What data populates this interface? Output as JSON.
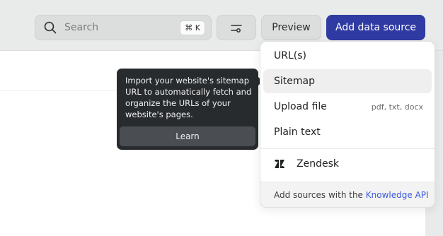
{
  "search": {
    "placeholder": "Search",
    "shortcut": "⌘ K",
    "icon": "search-icon"
  },
  "toolbar": {
    "filter_icon": "sliders-icon",
    "preview_label": "Preview",
    "add_label": "Add data source",
    "accent": "#2f3ba3"
  },
  "menu": {
    "items": [
      {
        "label": "URL(s)",
        "hint": ""
      },
      {
        "label": "Sitemap",
        "hint": ""
      },
      {
        "label": "Upload file",
        "hint": "pdf, txt, docx"
      },
      {
        "label": "Plain text",
        "hint": ""
      }
    ],
    "integration": {
      "label": "Zendesk",
      "icon": "zendesk-icon"
    },
    "footer": {
      "text": "Add sources with the",
      "link": "Knowledge API",
      "link_color": "#3b5bdb"
    }
  },
  "tooltip": {
    "text": "Import your website's sitemap URL to automatically fetch and organize the URLs of your website's pages.",
    "button": "Learn"
  }
}
